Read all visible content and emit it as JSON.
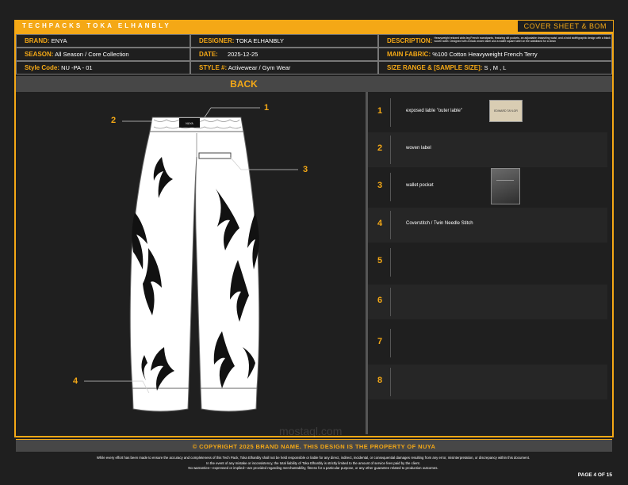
{
  "header": {
    "brand_title": "TECHPACKS TOKA ELHANBLY",
    "sheet_title": "COVER SHEET & BOM"
  },
  "info": {
    "brand_label": "BRAND:",
    "brand": "ENYA",
    "designer_label": "DESIGNER:",
    "designer": "TOKA ELHANBLY",
    "description_label": "DESCRIPTION:",
    "description": "Heavyweight relaxed wide-leg French sweatpants, featuring slit pockets, an adjustable drawstring waist, and a bold stoffrigraphic design with a black woven label. Designed with a black woven label and a wallet square label on the waistband for a clean",
    "season_label": "SEASON:",
    "season": "All Season / Core Collection",
    "date_label": "DATE:",
    "date": "2025-12-25",
    "fabric_label": "MAIN FABRIC:",
    "fabric": "%100 Cotton Heavyweight French Terry",
    "style_code_label": "Style Code:",
    "style_code": "NU -PA - 01",
    "style_label": "STYLE #:",
    "style": "Activewear / Gym Wear",
    "size_label": "SIZE RANGE & [SAMPLE SIZE]:",
    "size": "S , M , L"
  },
  "view_title": "BACK",
  "callouts": [
    "1",
    "2",
    "3",
    "4"
  ],
  "waist_label_text": "NUYA",
  "bom": [
    {
      "num": "1",
      "text": "exposed lable \"outer lable\"",
      "thumb": "label-photo",
      "label_text": "EDWARD TAYLOR"
    },
    {
      "num": "2",
      "text": "woven label"
    },
    {
      "num": "3",
      "text": "wallet pocket",
      "thumb": "pocket-photo"
    },
    {
      "num": "4",
      "text": "Coverstitch / Twin Needle Stitch"
    },
    {
      "num": "5",
      "text": ""
    },
    {
      "num": "6",
      "text": ""
    },
    {
      "num": "7",
      "text": ""
    },
    {
      "num": "8",
      "text": ""
    }
  ],
  "footer": {
    "copyright": "© COPYRIGHT 2025 BRAND NAME. THIS DESIGN IS THE PROPERTY OF NUYA",
    "disclaimer1": "While every effort has been made to ensure the accuracy and completeness of this Tech Pack, Toka Elhanbly shall not be held responsible or liable for any direct, indirect, incidental, or consequential damages resulting from any error, misinterpretation, or discrepancy within this document.",
    "disclaimer2": "In the event of any mistake or inconsistency, the total liability of Toka Elhanbly is strictly limited to the amount of service fees paid by the client.",
    "disclaimer3": "No warranties—expressed or implied—are provided regarding merchantability, fitness for a particular purpose, or any other guarantee related to production outcomes.",
    "page": "PAGE 4 OF 15"
  },
  "watermark": "mostaql.com",
  "colors": {
    "accent": "#f4a816",
    "background": "#1f1f1f",
    "panel": "#474747"
  }
}
